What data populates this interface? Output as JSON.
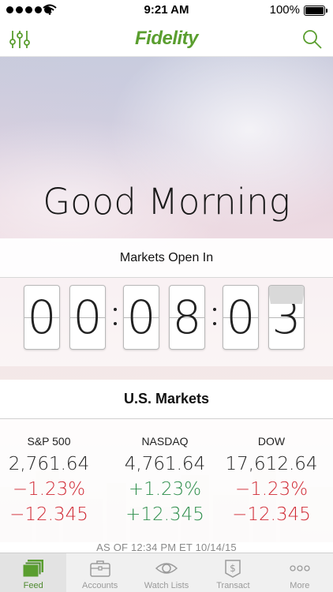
{
  "status_bar": {
    "time": "9:21 AM",
    "battery_percent": "100%",
    "signal_dots": 5
  },
  "nav": {
    "brand": "Fidelity",
    "brand_color": "#5a9e2f",
    "left_icon": "filter-sliders-icon",
    "right_icon": "search-icon"
  },
  "hero": {
    "greeting": "Good Morning"
  },
  "markets_open": {
    "label": "Markets Open In",
    "digits": [
      "0",
      "0",
      "0",
      "8",
      "0",
      "3"
    ]
  },
  "us_markets": {
    "title": "U.S. Markets",
    "indices": [
      {
        "name": "S&P 500",
        "value": "2,761.64",
        "pct_change": "−1.23%",
        "point_change": "−12.345",
        "direction": "down"
      },
      {
        "name": "NASDAQ",
        "value": "4,761.64",
        "pct_change": "+1.23%",
        "point_change": "+12.345",
        "direction": "up"
      },
      {
        "name": "DOW",
        "value": "17,612.64",
        "pct_change": "−1.23%",
        "point_change": "−12.345",
        "direction": "down"
      }
    ],
    "as_of": "AS OF 12:34 PM ET 10/14/15",
    "colors": {
      "down": "#d12b36",
      "up": "#2f8f4d"
    }
  },
  "tabs": [
    {
      "label": "Feed",
      "icon": "feed-stack-icon",
      "active": true
    },
    {
      "label": "Accounts",
      "icon": "briefcase-icon",
      "active": false
    },
    {
      "label": "Watch Lists",
      "icon": "eye-icon",
      "active": false
    },
    {
      "label": "Transact",
      "icon": "dollar-tag-icon",
      "active": false
    },
    {
      "label": "More",
      "icon": "more-dots-icon",
      "active": false
    }
  ]
}
